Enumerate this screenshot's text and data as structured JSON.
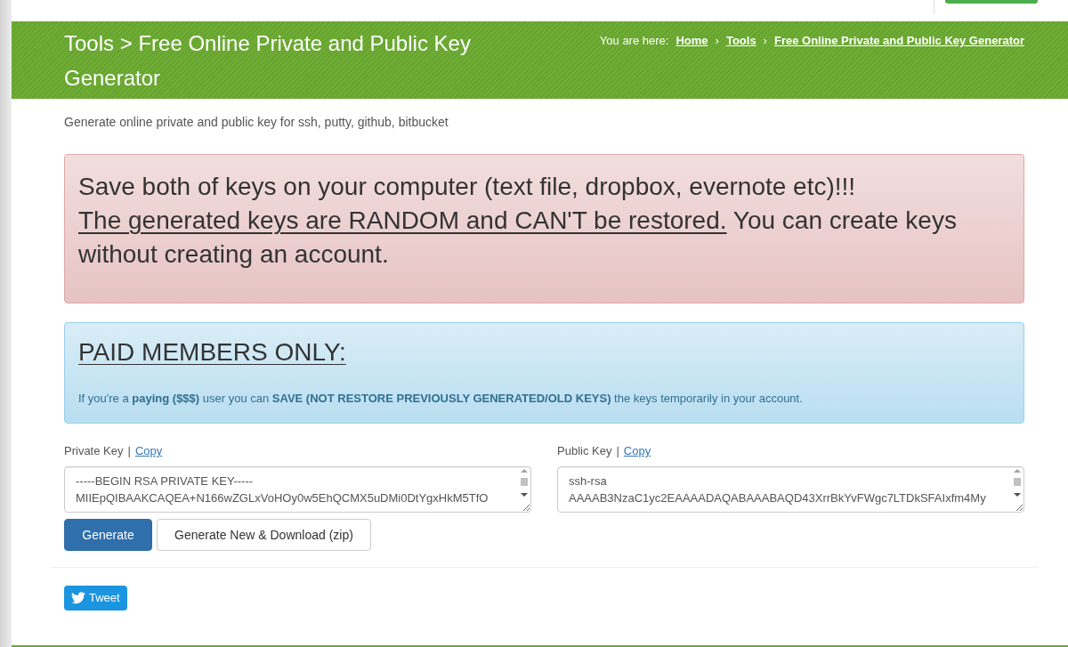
{
  "page_header": {
    "title": "Tools > Free Online Private and Public Key Generator",
    "breadcrumb": {
      "label": "You are here:",
      "items": [
        {
          "kind": "link",
          "text": "Home"
        },
        {
          "kind": "separator",
          "text": "›"
        },
        {
          "kind": "link",
          "text": "Tools"
        },
        {
          "kind": "separator",
          "text": "›"
        },
        {
          "kind": "link",
          "text": "Free Online Private and Public Key Generator"
        }
      ]
    }
  },
  "subtitle": "Generate online private and public key for ssh, putty, github, bitbucket",
  "warning": {
    "heading": "Save both of keys on your computer (text file, dropbox, evernote etc)!!!",
    "emphasis": "The generated keys are RANDOM and CAN'T be restored.",
    "note": "You can create keys without creating an account."
  },
  "paid_members": {
    "title": "PAID MEMBERS ONLY:",
    "text": "If you're a **paying ($$$)** user you can **SAVE (NOT RESTORE PREVIOUSLY GENERATED/OLD KEYS)** the keys temporarily in your account."
  },
  "keys": [
    {
      "label": "Private Key",
      "separator": "|",
      "copy": "Copy",
      "value": "-----BEGIN RSA PRIVATE KEY-----\nMIIEpQIBAAKCAQEA+N166wZGLxVoHOy0w5EhQCMX5uDMi0DtYgxHkM5TfO"
    },
    {
      "label": "Public Key",
      "separator": "|",
      "copy": "Copy",
      "value": "ssh-rsa\nAAAAB3NzaC1yc2EAAAADAQABAAABAQD43XrrBkYvFWgc7LTDkSFAIxfm4My"
    }
  ],
  "buttons": [
    {
      "kind": "primary",
      "label": "Generate"
    },
    {
      "kind": "default",
      "label": "Generate New & Download (zip)"
    }
  ],
  "share": {
    "label": "Tweet"
  }
}
